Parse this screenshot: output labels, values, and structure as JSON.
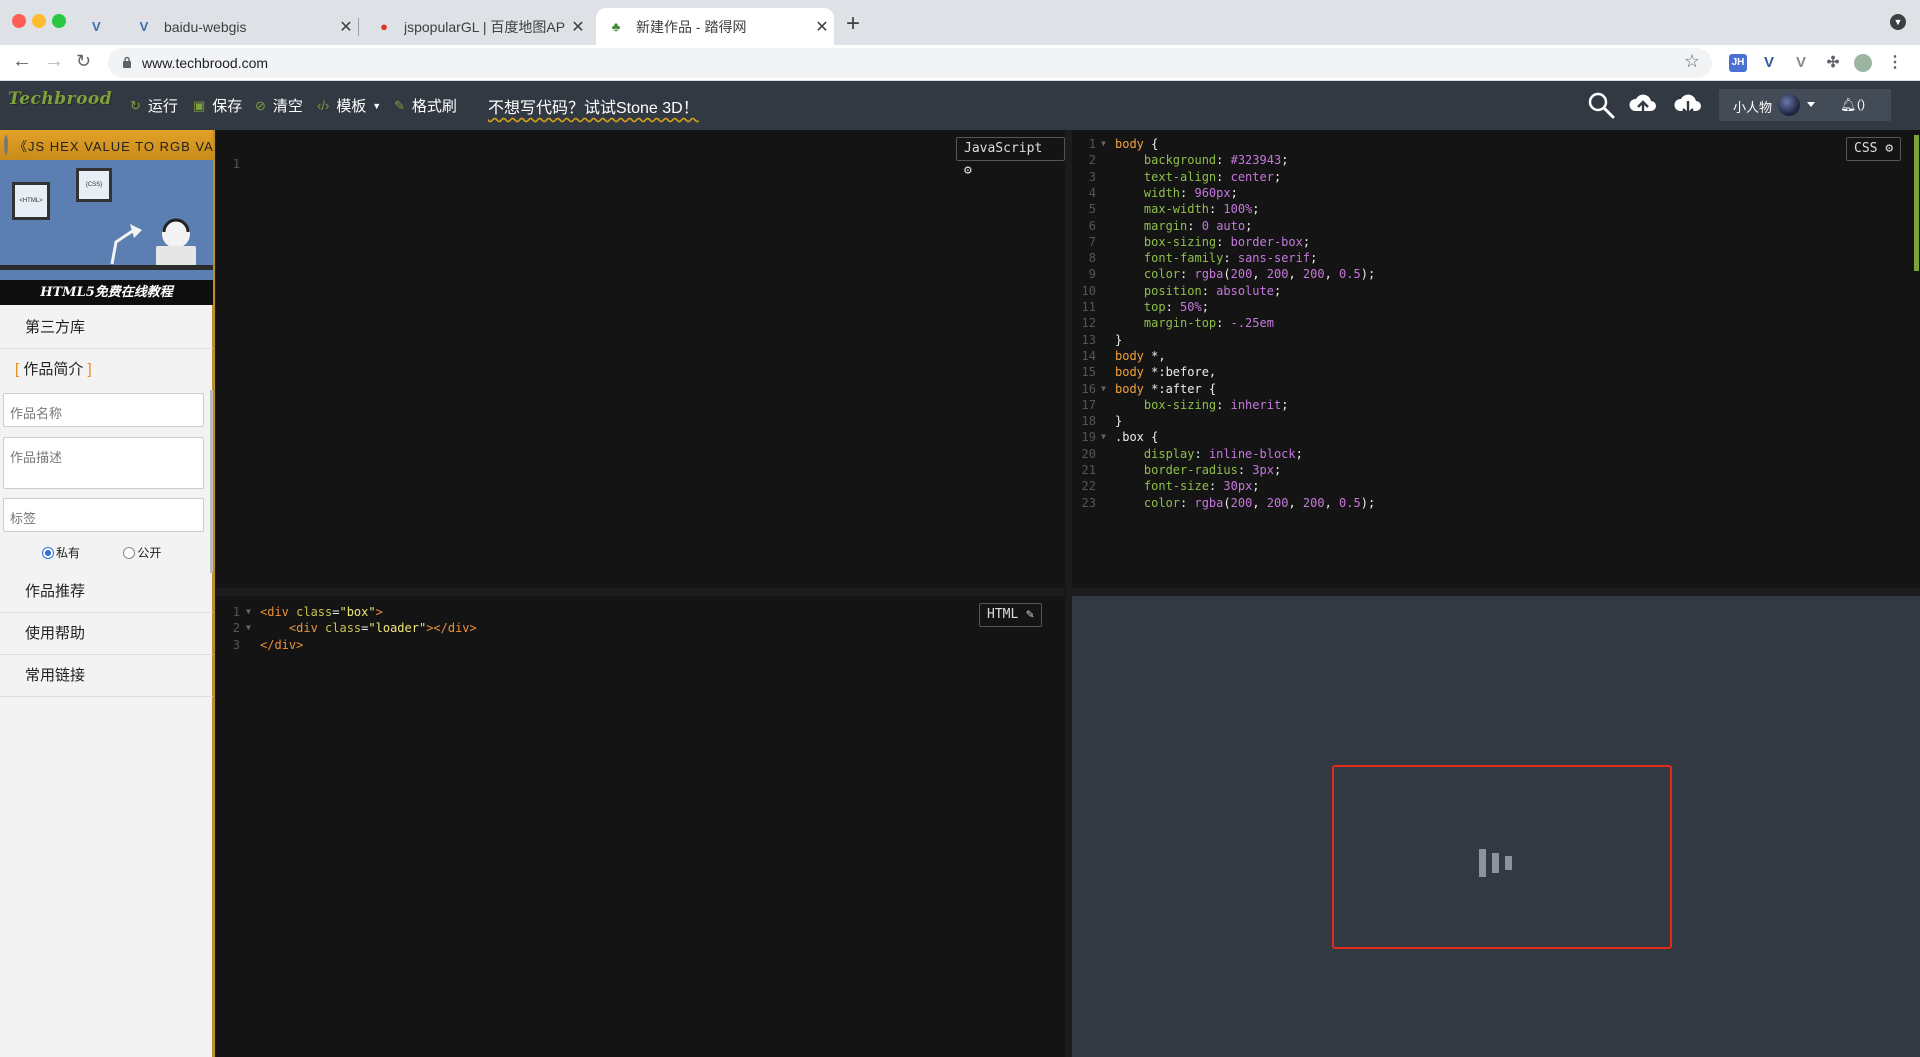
{
  "browser": {
    "tabs": [
      {
        "title": "baidu-webgis",
        "favicon": "vue-logo-icon"
      },
      {
        "title": "jspopularGL | 百度地图API SDK",
        "favicon": "map-pin-icon"
      },
      {
        "title": "新建作品 - 踏得网",
        "favicon": "sprout-icon",
        "active": true
      }
    ],
    "url": "www.techbrood.com",
    "extension_label": "JH"
  },
  "app": {
    "logo": "Techbrood",
    "toolbar": {
      "run": "运行",
      "save": "保存",
      "clear": "清空",
      "template": "模板",
      "format": "格式刷",
      "promo": "不想写代码？试试Stone 3D！"
    },
    "user": {
      "name": "小人物",
      "notifications_open": "(",
      "notifications_count": "",
      "notifications_close": ")"
    }
  },
  "sidebar": {
    "banner_ticker": "《JS HEX VALUE TO RGB VA",
    "banner_frame_left": "<HTML>",
    "banner_frame_right": "{CSS}",
    "banner_caption": "HTML5免费在线教程",
    "library": "第三方库",
    "intro_open": "[",
    "intro": "作品简介",
    "intro_close": "]",
    "name_placeholder": "作品名称",
    "desc_placeholder": "作品描述",
    "tags_placeholder": "标签",
    "radio_private": "私有",
    "radio_public": "公开",
    "recommend": "作品推荐",
    "help": "使用帮助",
    "links": "常用链接"
  },
  "editors": {
    "js": {
      "label": "JavaScript",
      "lines": [
        "1"
      ]
    },
    "css": {
      "label": "CSS",
      "line_numbers": [
        "1",
        "2",
        "3",
        "4",
        "5",
        "6",
        "7",
        "8",
        "9",
        "10",
        "11",
        "12",
        "13",
        "14",
        "15",
        "16",
        "17",
        "18",
        "19",
        "20",
        "21",
        "22",
        "23"
      ],
      "lines": [
        [
          [
            "k-sel",
            "body"
          ],
          [
            "k-punc",
            " {"
          ]
        ],
        [
          [
            "k-punc",
            "    "
          ],
          [
            "k-prop",
            "background"
          ],
          [
            "k-punc",
            ": "
          ],
          [
            "k-val",
            "#323943"
          ],
          [
            "k-punc",
            ";"
          ]
        ],
        [
          [
            "k-punc",
            "    "
          ],
          [
            "k-prop",
            "text-align"
          ],
          [
            "k-punc",
            ": "
          ],
          [
            "k-val",
            "center"
          ],
          [
            "k-punc",
            ";"
          ]
        ],
        [
          [
            "k-punc",
            "    "
          ],
          [
            "k-prop",
            "width"
          ],
          [
            "k-punc",
            ": "
          ],
          [
            "k-num",
            "960px"
          ],
          [
            "k-punc",
            ";"
          ]
        ],
        [
          [
            "k-punc",
            "    "
          ],
          [
            "k-prop",
            "max-width"
          ],
          [
            "k-punc",
            ": "
          ],
          [
            "k-num",
            "100%"
          ],
          [
            "k-punc",
            ";"
          ]
        ],
        [
          [
            "k-punc",
            "    "
          ],
          [
            "k-prop",
            "margin"
          ],
          [
            "k-punc",
            ": "
          ],
          [
            "k-num",
            "0"
          ],
          [
            "k-punc",
            " "
          ],
          [
            "k-val",
            "auto"
          ],
          [
            "k-punc",
            ";"
          ]
        ],
        [
          [
            "k-punc",
            "    "
          ],
          [
            "k-prop",
            "box-sizing"
          ],
          [
            "k-punc",
            ": "
          ],
          [
            "k-val",
            "border-box"
          ],
          [
            "k-punc",
            ";"
          ]
        ],
        [
          [
            "k-punc",
            "    "
          ],
          [
            "k-prop",
            "font-family"
          ],
          [
            "k-punc",
            ": "
          ],
          [
            "k-val",
            "sans-serif"
          ],
          [
            "k-punc",
            ";"
          ]
        ],
        [
          [
            "k-punc",
            "    "
          ],
          [
            "k-prop",
            "color"
          ],
          [
            "k-punc",
            ": "
          ],
          [
            "k-val",
            "rgba"
          ],
          [
            "k-punc",
            "("
          ],
          [
            "k-num",
            "200"
          ],
          [
            "k-punc",
            ", "
          ],
          [
            "k-num",
            "200"
          ],
          [
            "k-punc",
            ", "
          ],
          [
            "k-num",
            "200"
          ],
          [
            "k-punc",
            ", "
          ],
          [
            "k-num",
            "0.5"
          ],
          [
            "k-punc",
            ");"
          ]
        ],
        [
          [
            "k-punc",
            "    "
          ],
          [
            "k-prop",
            "position"
          ],
          [
            "k-punc",
            ": "
          ],
          [
            "k-val",
            "absolute"
          ],
          [
            "k-punc",
            ";"
          ]
        ],
        [
          [
            "k-punc",
            "    "
          ],
          [
            "k-prop",
            "top"
          ],
          [
            "k-punc",
            ": "
          ],
          [
            "k-num",
            "50%"
          ],
          [
            "k-punc",
            ";"
          ]
        ],
        [
          [
            "k-punc",
            "    "
          ],
          [
            "k-prop",
            "margin-top"
          ],
          [
            "k-punc",
            ": "
          ],
          [
            "k-num",
            "-.25em"
          ]
        ],
        [
          [
            "k-punc",
            "}"
          ]
        ],
        [
          [
            "k-sel",
            "body"
          ],
          [
            "k-punc",
            " *,"
          ]
        ],
        [
          [
            "k-sel",
            "body"
          ],
          [
            "k-punc",
            " *:before,"
          ]
        ],
        [
          [
            "k-sel",
            "body"
          ],
          [
            "k-punc",
            " *:after {"
          ]
        ],
        [
          [
            "k-punc",
            "    "
          ],
          [
            "k-prop",
            "box-sizing"
          ],
          [
            "k-punc",
            ": "
          ],
          [
            "k-val",
            "inherit"
          ],
          [
            "k-punc",
            ";"
          ]
        ],
        [
          [
            "k-punc",
            "}"
          ]
        ],
        [
          [
            "k-punc",
            ".box {"
          ]
        ],
        [
          [
            "k-punc",
            "    "
          ],
          [
            "k-prop",
            "display"
          ],
          [
            "k-punc",
            ": "
          ],
          [
            "k-val",
            "inline-block"
          ],
          [
            "k-punc",
            ";"
          ]
        ],
        [
          [
            "k-punc",
            "    "
          ],
          [
            "k-prop",
            "border-radius"
          ],
          [
            "k-punc",
            ": "
          ],
          [
            "k-num",
            "3px"
          ],
          [
            "k-punc",
            ";"
          ]
        ],
        [
          [
            "k-punc",
            "    "
          ],
          [
            "k-prop",
            "font-size"
          ],
          [
            "k-punc",
            ": "
          ],
          [
            "k-num",
            "30px"
          ],
          [
            "k-punc",
            ";"
          ]
        ],
        [
          [
            "k-punc",
            "    "
          ],
          [
            "k-prop",
            "color"
          ],
          [
            "k-punc",
            ": "
          ],
          [
            "k-val",
            "rgba"
          ],
          [
            "k-punc",
            "("
          ],
          [
            "k-num",
            "200"
          ],
          [
            "k-punc",
            ", "
          ],
          [
            "k-num",
            "200"
          ],
          [
            "k-punc",
            ", "
          ],
          [
            "k-num",
            "200"
          ],
          [
            "k-punc",
            ", "
          ],
          [
            "k-num",
            "0.5"
          ],
          [
            "k-punc",
            ");"
          ]
        ]
      ],
      "folds": [
        0,
        15,
        18
      ]
    },
    "html": {
      "label": "HTML",
      "line_numbers": [
        "1",
        "2",
        "3"
      ],
      "lines": [
        [
          [
            "k-tag",
            "<div "
          ],
          [
            "k-attr",
            "class"
          ],
          [
            "k-punc",
            "="
          ],
          [
            "k-str",
            "\"box\""
          ],
          [
            "k-tag",
            ">"
          ]
        ],
        [
          [
            "k-punc",
            "    "
          ],
          [
            "k-tag",
            "<div "
          ],
          [
            "k-attr",
            "class"
          ],
          [
            "k-punc",
            "="
          ],
          [
            "k-str",
            "\"loader\""
          ],
          [
            "k-tag",
            "></div>"
          ]
        ],
        [
          [
            "k-tag",
            "</div>"
          ]
        ]
      ],
      "folds": [
        0,
        1
      ]
    }
  },
  "colors": {
    "toolbar_bg": "#323943",
    "accent_green": "#7da23a",
    "preview_border": "#e42a1a",
    "sidebar_border": "#b98e2b"
  }
}
